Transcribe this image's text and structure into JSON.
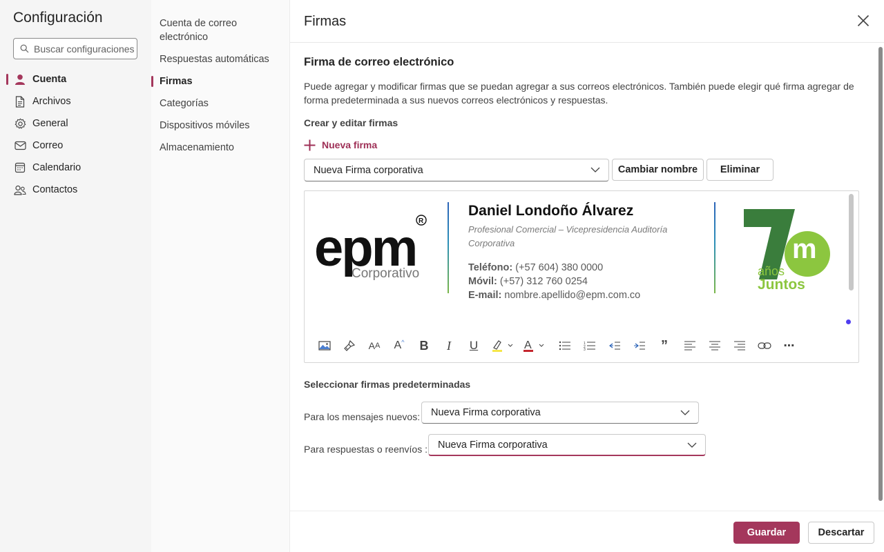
{
  "app": {
    "title": "Configuración",
    "search_placeholder": "Buscar configuraciones"
  },
  "nav": {
    "items": [
      {
        "label": "Cuenta",
        "icon": "person-icon",
        "active": true
      },
      {
        "label": "Archivos",
        "icon": "file-icon"
      },
      {
        "label": "General",
        "icon": "gear-icon"
      },
      {
        "label": "Correo",
        "icon": "mail-icon"
      },
      {
        "label": "Calendario",
        "icon": "calendar-icon"
      },
      {
        "label": "Contactos",
        "icon": "people-icon"
      }
    ]
  },
  "subnav": {
    "items": [
      {
        "label": "Cuenta de correo electrónico"
      },
      {
        "label": "Respuestas automáticas"
      },
      {
        "label": "Firmas",
        "active": true
      },
      {
        "label": "Categorías"
      },
      {
        "label": "Dispositivos móviles"
      },
      {
        "label": "Almacenamiento"
      }
    ]
  },
  "panel": {
    "title": "Firmas",
    "section_title": "Firma de correo electrónico",
    "description": "Puede agregar y modificar firmas que se puedan agregar a sus correos electrónicos. También puede elegir qué firma agregar de forma predeterminada a sus nuevos correos electrónicos y respuestas.",
    "create_label": "Crear y editar firmas",
    "new_signature": "Nueva firma",
    "selected_signature": "Nueva Firma corporativa",
    "rename_button": "Cambiar nombre",
    "delete_button": "Eliminar"
  },
  "signature": {
    "logo_text": "epm",
    "logo_registered": "®",
    "logo_subtitle": "Corporativo",
    "name": "Daniel Londoño Álvarez",
    "role": "Profesional Comercial – Vicepresidencia Auditoría Corporativa",
    "phone_label": "Teléfono:",
    "phone_value": "(+57 604) 380 0000",
    "mobile_label": "Móvil:",
    "mobile_value": "(+57) 312 760 0254",
    "email_label": "E-mail:",
    "email_value": "nombre.apellido@epm.com.co",
    "badge_number": "7",
    "badge_letter": "m",
    "badge_line1": "años",
    "badge_line2": "Juntos"
  },
  "toolbar": {
    "icons": [
      "insert-image-icon",
      "format-painter-icon",
      "font-size-icon",
      "increase-font-icon",
      "bold-icon",
      "italic-icon",
      "underline-icon",
      "highlight-icon",
      "font-color-icon",
      "bullets-icon",
      "numbering-icon",
      "decrease-indent-icon",
      "increase-indent-icon",
      "quote-icon",
      "align-left-icon",
      "align-center-icon",
      "align-right-icon",
      "link-icon",
      "more-icon"
    ]
  },
  "defaults": {
    "title": "Seleccionar firmas predeterminadas",
    "new_messages_label": "Para los mensajes nuevos:",
    "new_messages_value": "Nueva Firma corporativa",
    "replies_label": "Para respuestas o reenvíos :",
    "replies_value": "Nueva Firma corporativa"
  },
  "footer": {
    "save": "Guardar",
    "discard": "Descartar"
  },
  "colors": {
    "accent": "#a4375c",
    "epm_green": "#3a7d3c",
    "epm_lightgreen": "#8cc63f"
  }
}
